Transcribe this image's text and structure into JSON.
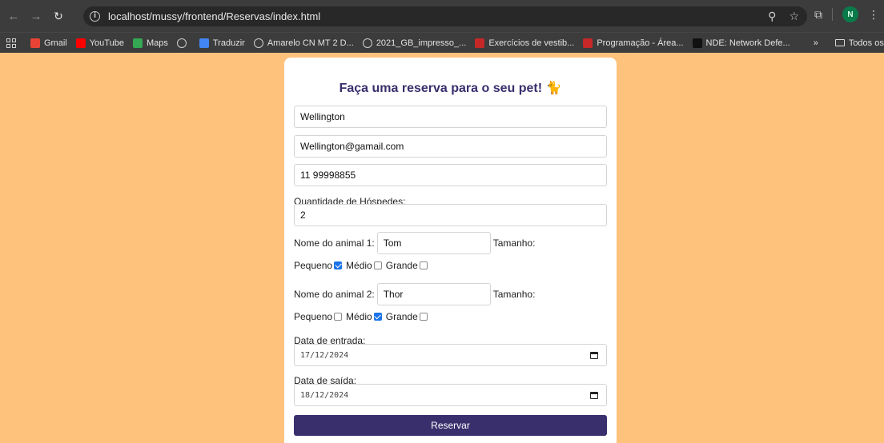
{
  "browser": {
    "url": "localhost/mussy/frontend/Reservas/index.html",
    "profile_initial": "N",
    "bookmarks": [
      {
        "label": "Gmail",
        "icon": "gmail-icon",
        "color": "#ea4335"
      },
      {
        "label": "YouTube",
        "icon": "youtube-icon",
        "color": "#ff0000"
      },
      {
        "label": "Maps",
        "icon": "maps-icon",
        "color": "#34a853"
      },
      {
        "label": "",
        "icon": "globe-icon",
        "color": "#cfcfcf"
      },
      {
        "label": "Traduzir",
        "icon": "translate-icon",
        "color": "#4285f4"
      },
      {
        "label": "Amarelo CN MT 2 D...",
        "icon": "globe-icon",
        "color": "#cfcfcf"
      },
      {
        "label": "2021_GB_impresso_...",
        "icon": "globe-icon",
        "color": "#cfcfcf"
      },
      {
        "label": "Exercícios de vestib...",
        "icon": "site-icon",
        "color": "#c62828"
      },
      {
        "label": "Programação - Área...",
        "icon": "site-icon",
        "color": "#c62828"
      },
      {
        "label": "NDE: Network Defe...",
        "icon": "nde-icon",
        "color": "#111111"
      }
    ],
    "more_label": "»",
    "all_bookmarks_label": "Todos os favoritos"
  },
  "form": {
    "title": "Faça uma reserva para o seu pet!",
    "title_emoji": "🐈",
    "name_value": "Wellington",
    "email_value": "Wellington@gamail.com",
    "phone_value": "11 99998855",
    "guests_label": "Quantidade de Hóspedes:",
    "guests_value": "2",
    "size_label": "Tamanho:",
    "size_options": [
      "Pequeno",
      "Médio",
      "Grande"
    ],
    "animals": [
      {
        "label": "Nome do animal 1:",
        "name": "Tom",
        "size_checked": [
          true,
          false,
          false
        ]
      },
      {
        "label": "Nome do animal 2:",
        "name": "Thor",
        "size_checked": [
          false,
          true,
          false
        ]
      }
    ],
    "checkin_label": "Data de entrada:",
    "checkin_value": "17/12/2024",
    "checkout_label": "Data de saída:",
    "checkout_value": "18/12/2024",
    "submit_label": "Reservar"
  },
  "colors": {
    "page_background": "#ffc27d",
    "primary": "#3a2f6d",
    "checkbox_checked": "#1a73e8"
  }
}
